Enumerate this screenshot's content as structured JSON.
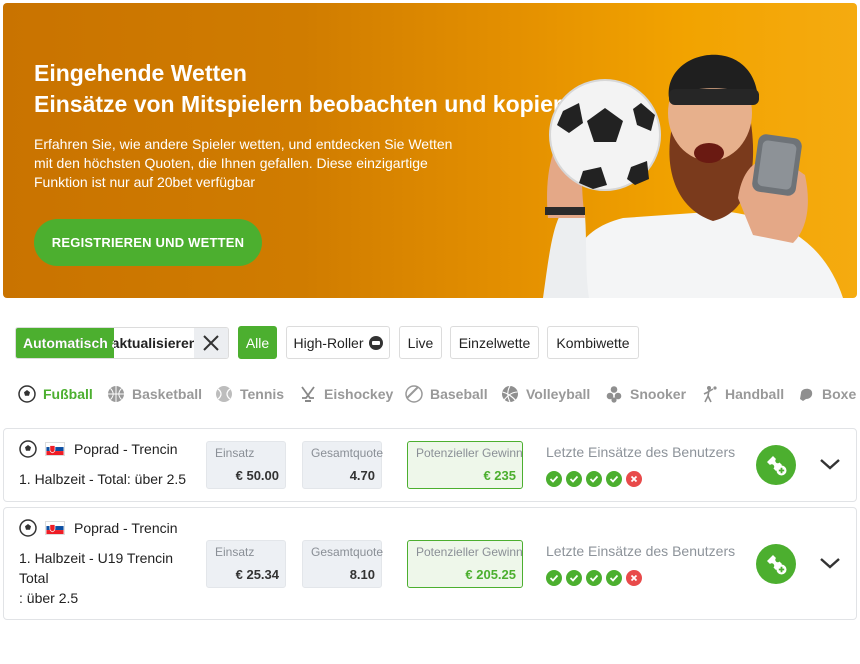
{
  "banner": {
    "title_line1": "Eingehende Wetten",
    "title_line2": "Einsätze von Mitspielern beobachten und kopieren",
    "description": "Erfahren Sie, wie andere Spieler wetten, und entdecken Sie Wetten mit den höchsten Quoten, die Ihnen gefallen. Diese einzigartige Funktion ist nur auf 20bet verfügbar",
    "cta": "REGISTRIEREN UND WETTEN",
    "colors": {
      "gradient_start": "#c97300",
      "gradient_end": "#f5ab10",
      "cta": "#4caf2f"
    }
  },
  "filters": {
    "auto_update_label": "Automatisch aktualisieren",
    "chips": [
      "Alle",
      "High-Roller",
      "Live",
      "Einzelwette",
      "Kombiwette"
    ],
    "active_chip": "Alle"
  },
  "sports": [
    {
      "label": "Fußball",
      "icon": "soccer-ball-icon",
      "active": true
    },
    {
      "label": "Basketball",
      "icon": "basketball-icon",
      "active": false
    },
    {
      "label": "Tennis",
      "icon": "tennis-ball-icon",
      "active": false
    },
    {
      "label": "Eishockey",
      "icon": "hockey-sticks-icon",
      "active": false
    },
    {
      "label": "Baseball",
      "icon": "baseball-icon",
      "active": false
    },
    {
      "label": "Volleyball",
      "icon": "volleyball-icon",
      "active": false
    },
    {
      "label": "Snooker",
      "icon": "snooker-balls-icon",
      "active": false
    },
    {
      "label": "Handball",
      "icon": "handball-player-icon",
      "active": false
    },
    {
      "label": "Boxe",
      "icon": "boxing-glove-icon",
      "active": false
    }
  ],
  "bets": [
    {
      "match": "Poprad - Trencin",
      "market": "1. Halbzeit - Total: über 2.5",
      "stake_label": "Einsatz",
      "stake": "€ 50.00",
      "odds_label": "Gesamtquoten",
      "odds": "4.70",
      "win_label": "Potenzieller Gewinn",
      "win": "€ 235",
      "recent_label": "Letzte Einsätze des Benutzers",
      "recent_results": [
        "won",
        "won",
        "won",
        "won",
        "lost"
      ]
    },
    {
      "match": "Poprad - Trencin",
      "market_line1": "1. Halbzeit - U19 Trencin",
      "market_line2": "Total",
      "market_line3": ": über 2.5",
      "stake_label": "Einsatz",
      "stake": "€ 25.34",
      "odds_label": "Gesamtquoten",
      "odds": "8.10",
      "win_label": "Potenzieller Gewinn",
      "win": "€ 205.25",
      "recent_label": "Letzte Einsätze des Benutzers",
      "recent_results": [
        "won",
        "won",
        "won",
        "won",
        "lost"
      ]
    }
  ],
  "colors": {
    "accent": "#4caf2f",
    "loss": "#e84a4a",
    "muted": "#999999"
  }
}
